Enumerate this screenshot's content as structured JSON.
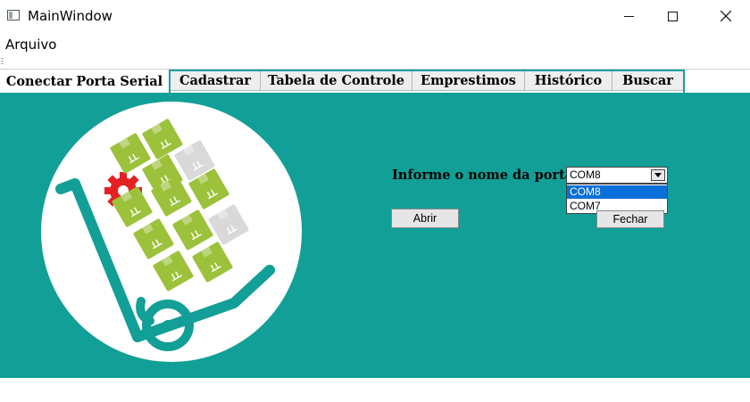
{
  "window": {
    "title": "MainWindow"
  },
  "menu": {
    "items": [
      "Arquivo"
    ]
  },
  "tabs": [
    {
      "label": "Conectar Porta Serial",
      "active": true
    },
    {
      "label": "Cadastrar"
    },
    {
      "label": "Tabela de Controle"
    },
    {
      "label": "Emprestimos"
    },
    {
      "label": "Histórico"
    },
    {
      "label": "Buscar"
    }
  ],
  "serial_form": {
    "port_label": "Informe o nome da porta:",
    "port_selected": "COM8",
    "port_options": [
      "COM8",
      "COM7"
    ],
    "open_button": "Abrir",
    "close_button": "Fechar"
  },
  "colors": {
    "panel_background": "#129f97",
    "selection": "#0a6fd8",
    "box_green": "#9cc13b",
    "box_grey": "#d9d9d9",
    "gear_red": "#e32024"
  },
  "icons": [
    "app-window-icon",
    "minimize-icon",
    "maximize-icon",
    "close-icon",
    "chevron-down-icon",
    "hand-truck-boxes-illustration",
    "gear-icon"
  ]
}
